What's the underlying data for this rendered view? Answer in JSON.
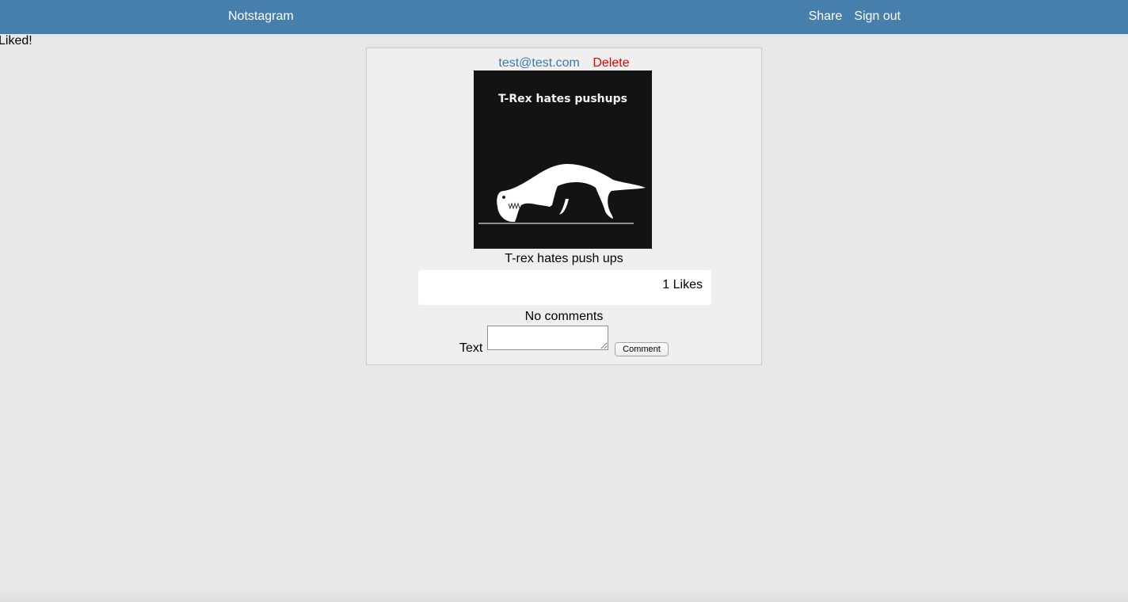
{
  "navbar": {
    "brand": "Notstagram",
    "share_label": "Share",
    "signout_label": "Sign out",
    "background_color": "#467fab"
  },
  "flash": {
    "message": "Liked!"
  },
  "post": {
    "author": "test@test.com",
    "delete_label": "Delete",
    "image_title": "T-Rex hates pushups",
    "image_icon": "t-rex-pushup-illustration",
    "caption": "T-rex hates push ups",
    "likes_label": "1 Likes",
    "comments_status": "No comments",
    "comment_form": {
      "label": "Text",
      "textarea_value": "",
      "button_label": "Comment"
    }
  },
  "colors": {
    "page_background": "#e7e7e7",
    "card_background": "#efefef",
    "author_link": "#3b79b0",
    "delete_link": "#ee0000"
  }
}
